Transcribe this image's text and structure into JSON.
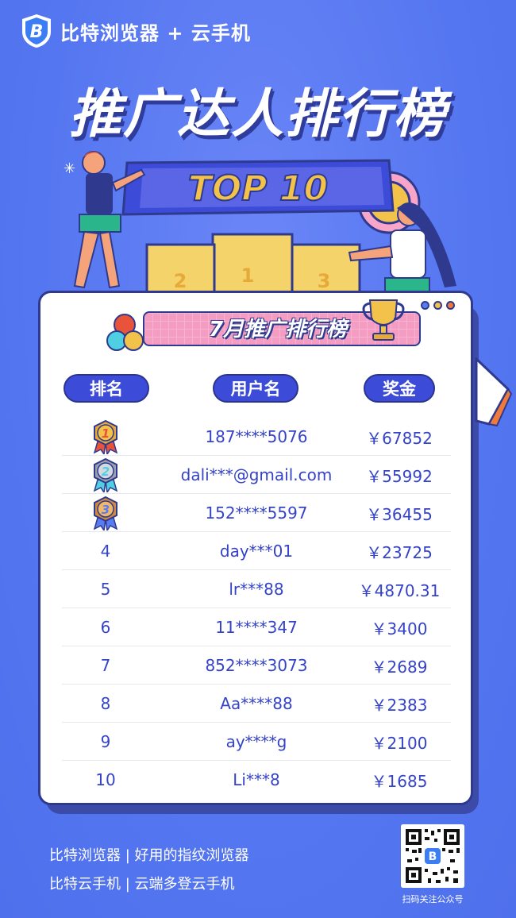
{
  "brand": {
    "name": "比特浏览器 + 云手机",
    "logo_icon": "bitbrowser-logo-icon"
  },
  "title": "推广达人排行榜",
  "top_badge": "TOP 10",
  "podium": {
    "first": "1",
    "second": "2",
    "third": "3"
  },
  "subtitle": "7月推广排行榜",
  "columns": {
    "rank": "排名",
    "user": "用户名",
    "prize": "奖金"
  },
  "rows": [
    {
      "rank": "1",
      "medal": "gold",
      "user": "187****5076",
      "prize": "￥67852"
    },
    {
      "rank": "2",
      "medal": "silver",
      "user": "dali***@gmail.com",
      "prize": "￥55992"
    },
    {
      "rank": "3",
      "medal": "bronze",
      "user": "152****5597",
      "prize": "￥36455"
    },
    {
      "rank": "4",
      "user": "day***01",
      "prize": "￥23725"
    },
    {
      "rank": "5",
      "user": "lr***88",
      "prize": "￥4870.31"
    },
    {
      "rank": "6",
      "user": "11****347",
      "prize": "￥3400"
    },
    {
      "rank": "7",
      "user": "852****3073",
      "prize": "￥2689"
    },
    {
      "rank": "8",
      "user": "Aa****88",
      "prize": "￥2383"
    },
    {
      "rank": "9",
      "user": "ay****g",
      "prize": "￥2100"
    },
    {
      "rank": "10",
      "user": "Li***8",
      "prize": "￥1685"
    }
  ],
  "footer": {
    "line1": "比特浏览器 | 好用的指纹浏览器",
    "line2": "比特云手机 | 云端多登云手机",
    "qr_caption": "扫码关注公众号"
  },
  "colors": {
    "background": "#5a7cf3",
    "accent": "#3d4bd9",
    "text_blue": "#3543c8",
    "gold": "#f3c24a"
  }
}
